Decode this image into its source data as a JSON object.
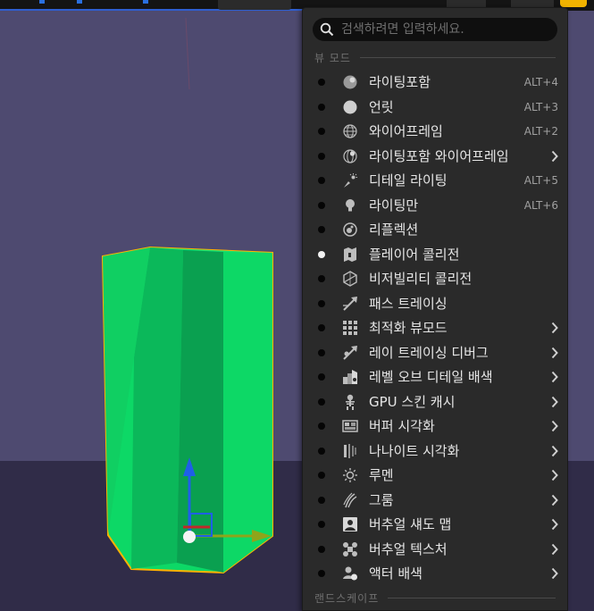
{
  "search": {
    "placeholder": "검색하려면 입력하세요."
  },
  "section_view_mode": "뷰 모드",
  "section_landscape": "랜드스케이프",
  "colors": {
    "accent_blue": "#2f5fd0",
    "yellow_badge": "#f1b300",
    "mesh_green": "#0dd866",
    "selection_outline": "#ffb300"
  },
  "items": [
    {
      "label": "라이팅포함",
      "icon": "lit-sphere-icon",
      "shortcut": "ALT+4",
      "submenu": false,
      "selected": false
    },
    {
      "label": "언릿",
      "icon": "unlit-sphere-icon",
      "shortcut": "ALT+3",
      "submenu": false,
      "selected": false
    },
    {
      "label": "와이어프레임",
      "icon": "wireframe-sphere-icon",
      "shortcut": "ALT+2",
      "submenu": false,
      "selected": false
    },
    {
      "label": "라이팅포함 와이어프레임",
      "icon": "lit-wireframe-icon",
      "shortcut": "",
      "submenu": true,
      "selected": false
    },
    {
      "label": "디테일 라이팅",
      "icon": "detail-lighting-icon",
      "shortcut": "ALT+5",
      "submenu": false,
      "selected": false
    },
    {
      "label": "라이팅만",
      "icon": "lightbulb-icon",
      "shortcut": "ALT+6",
      "submenu": false,
      "selected": false
    },
    {
      "label": "리플렉션",
      "icon": "reflection-icon",
      "shortcut": "",
      "submenu": false,
      "selected": false
    },
    {
      "label": "플레이어 콜리전",
      "icon": "player-collision-icon",
      "shortcut": "",
      "submenu": false,
      "selected": true
    },
    {
      "label": "비저빌리티 콜리전",
      "icon": "visibility-collision-icon",
      "shortcut": "",
      "submenu": false,
      "selected": false
    },
    {
      "label": "패스 트레이싱",
      "icon": "path-tracing-icon",
      "shortcut": "",
      "submenu": false,
      "selected": false
    },
    {
      "label": "최적화 뷰모드",
      "icon": "optimization-grid-icon",
      "shortcut": "",
      "submenu": true,
      "selected": false
    },
    {
      "label": "레이 트레이싱 디버그",
      "icon": "ray-tracing-debug-icon",
      "shortcut": "",
      "submenu": true,
      "selected": false
    },
    {
      "label": "레벨 오브 디테일 배색",
      "icon": "lod-coloration-icon",
      "shortcut": "",
      "submenu": true,
      "selected": false
    },
    {
      "label": "GPU 스킨 캐시",
      "icon": "skeleton-icon",
      "shortcut": "",
      "submenu": true,
      "selected": false
    },
    {
      "label": "버퍼 시각화",
      "icon": "buffer-visualization-icon",
      "shortcut": "",
      "submenu": true,
      "selected": false
    },
    {
      "label": "나나이트 시각화",
      "icon": "nanite-icon",
      "shortcut": "",
      "submenu": true,
      "selected": false
    },
    {
      "label": "루멘",
      "icon": "lumen-sun-icon",
      "shortcut": "",
      "submenu": true,
      "selected": false
    },
    {
      "label": "그룸",
      "icon": "groom-hair-icon",
      "shortcut": "",
      "submenu": true,
      "selected": false
    },
    {
      "label": "버추얼 섀도 맵",
      "icon": "virtual-shadow-map-icon",
      "shortcut": "",
      "submenu": true,
      "selected": false
    },
    {
      "label": "버추얼 텍스처",
      "icon": "virtual-texture-icon",
      "shortcut": "",
      "submenu": true,
      "selected": false
    },
    {
      "label": "액터 배색",
      "icon": "actor-coloration-icon",
      "shortcut": "",
      "submenu": true,
      "selected": false
    }
  ]
}
